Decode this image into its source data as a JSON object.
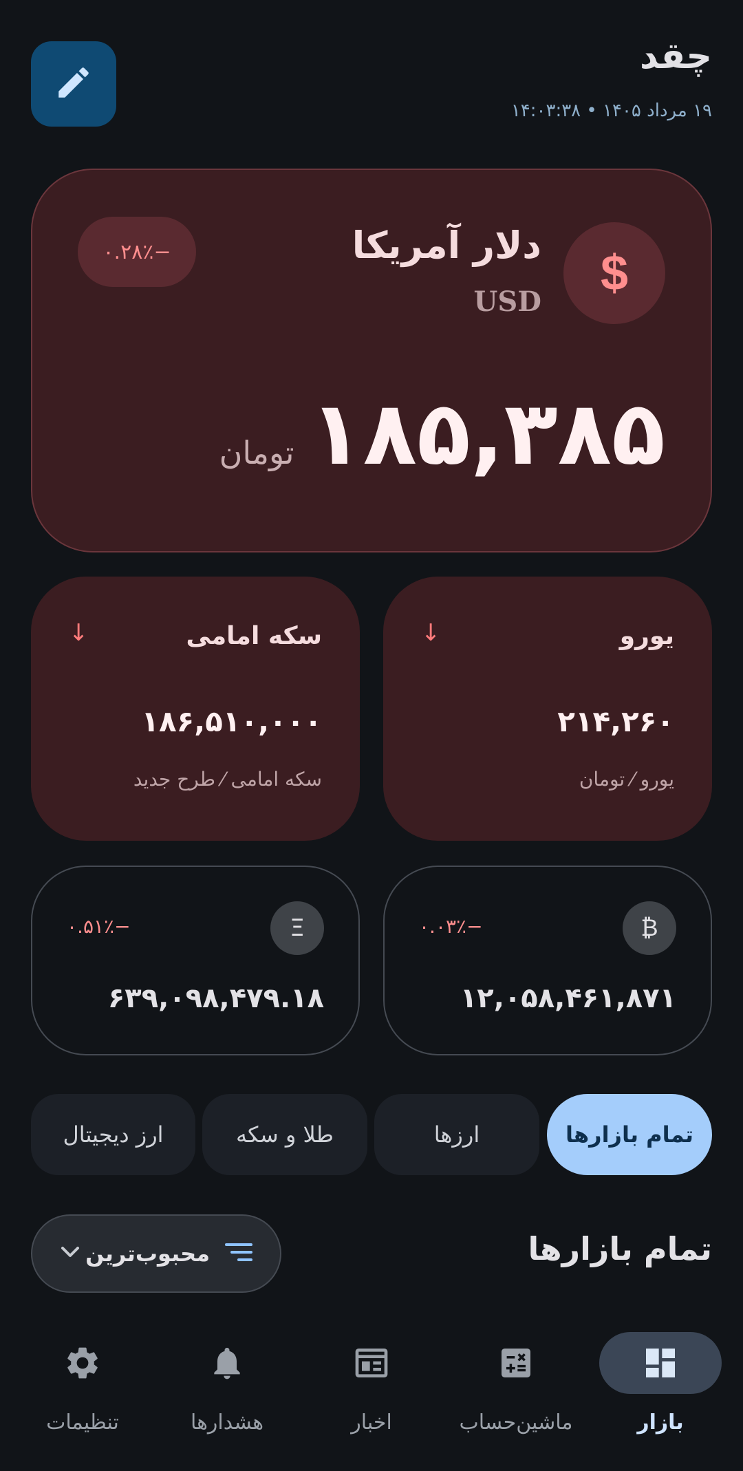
{
  "header": {
    "title": "چقد",
    "subtitle": "۱۹ مرداد ۱۴۰۵ • ۱۴:۰۳:۳۸"
  },
  "hero": {
    "icon": "dollar-icon",
    "name": "دلار آمریکا",
    "code": "USD",
    "change": "−۰.۲۸٪",
    "price": "۱۸۵,۳۸۵",
    "unit": "تومان"
  },
  "cards": [
    {
      "title": "یورو",
      "arrow": "↓",
      "value": "۲۱۴,۲۶۰",
      "sub": "یورو ⁄ تومان"
    },
    {
      "title": "سکه امامی",
      "arrow": "↓",
      "value": "۱۸۶,۵۱۰,۰۰۰",
      "sub": "سکه امامی ⁄ طرح جدید"
    }
  ],
  "crypto": [
    {
      "icon": "bitcoin-icon",
      "symbol": "₿",
      "change": "−۰.۰۳٪",
      "value": "۱۲,۰۵۸,۴۶۱,۸۷۱"
    },
    {
      "icon": "ethereum-icon",
      "symbol": "Ξ",
      "change": "−۰.۵۱٪",
      "value": "۶۳۹,۰۹۸,۴۷۹.۱۸"
    }
  ],
  "filters": [
    "تمام بازارها",
    "ارزها",
    "طلا و سکه",
    "ارز دیجیتال"
  ],
  "section": {
    "title": "تمام بازارها",
    "sort_label": "محبوب‌ترین"
  },
  "nav": [
    "بازار",
    "ماشین‌حساب",
    "اخبار",
    "هشدارها",
    "تنظیمات"
  ],
  "colors": {
    "background": "#111418",
    "card_red": "#3b1d21",
    "accent_blue": "#a4cdfb",
    "negative": "#ff8e8e"
  }
}
